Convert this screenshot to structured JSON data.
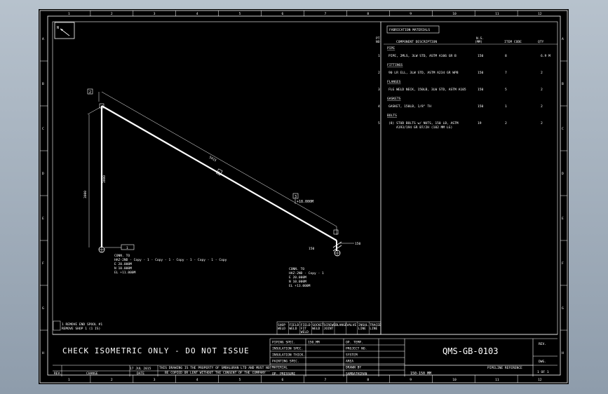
{
  "north": "N",
  "bom": {
    "title": "FABRICATION MATERIALS",
    "head_pt": "PT",
    "head_no": "NO",
    "head_desc": "COMPONENT DESCRIPTION",
    "head_ns": "N.S.",
    "head_mm": "(MM)",
    "head_item": "ITEM CODE",
    "head_qty": "QTY",
    "sections": [
      {
        "label": "PIPE",
        "rows": [
          {
            "no": "1",
            "desc": "PIPE, 2MLS, 3LW STD, ASTM A106 GR B",
            "ns": "150",
            "code": "8",
            "qty": "6.9 M"
          }
        ]
      },
      {
        "label": "FITTINGS",
        "rows": [
          {
            "no": "2",
            "desc": "90 LR ELL, 3LW STD, ASTM A234 GR WPB",
            "ns": "150",
            "code": "7",
            "qty": "2"
          }
        ]
      },
      {
        "label": "FLANGES",
        "rows": [
          {
            "no": "3",
            "desc": "FLG WELD NECK, 150LB, 3LW STD, ASTM A105",
            "ns": "150",
            "code": "5",
            "qty": "2"
          }
        ]
      },
      {
        "label": "GASKETS",
        "rows": [
          {
            "no": "4",
            "desc": "GASKET, 150LB, 1/8\" TH",
            "ns": "150",
            "code": "1",
            "qty": "2"
          }
        ]
      },
      {
        "label": "BOLTS",
        "rows": [
          {
            "no": "5",
            "desc": "(8) STUD BOLTS w/ NUTS, 150 LB, ASTM",
            "desc2": "A193/194 GR B7/2H (102 MM LG)",
            "ns": "19",
            "code": "2",
            "qty": "2"
          }
        ]
      }
    ]
  },
  "iso": {
    "label_2": "2",
    "label_1": "1",
    "label_3": "3",
    "dim_diag": "5415",
    "dim_vert": "3000",
    "dim_vert2": "3000",
    "dim_right": "150",
    "dim_right2": "150",
    "elev": "+18.000M",
    "conn_a": {
      "tag": "1",
      "l1": "CONN. TO",
      "l2": "HAZ-2ND - Copy - 1 - Copy - 1 - Copy - 1 - Copy - 1 - Copy",
      "l3": "E 20.000M",
      "l4": "N 10.000M",
      "l5": "EL +11.000M"
    },
    "conn_b": {
      "l1": "CONN. TO",
      "l2": "HAZ-2ND - Copy - 1",
      "l3": "E 20.000M",
      "l4": "N 10.000M",
      "l5": "EL +13.000M"
    }
  },
  "notes_left": {
    "l1": "1 REMOVE END SPOOL #1",
    "l2": "REMOVE SHOP 1 (1 IS)"
  },
  "symbols": [
    "SHOP WELD",
    "FIELD WELD",
    "FIELD FIT WELD",
    "SOCKET WELD",
    "SCREWED JOINT",
    "FLANGE",
    "VALVE",
    "INSUL. LINE",
    "TRACED LINE"
  ],
  "title_block": {
    "check": "CHECK ISOMETRIC ONLY - DO NOT ISSUE",
    "fields": [
      {
        "k": "PIPING SPEC.",
        "v": "150_MM"
      },
      {
        "k": "INSULATION SPEC.",
        "v": ""
      },
      {
        "k": "INSULATION THICK.",
        "v": ""
      },
      {
        "k": "PAINTING SPEC.",
        "v": ""
      },
      {
        "k": "MATERIAL",
        "v": ""
      },
      {
        "k": "OP. PRESSURE",
        "v": ""
      }
    ],
    "fields2": [
      {
        "k": "OP. TEMP.",
        "v": ""
      },
      {
        "k": "PROJECT NO.",
        "v": ""
      },
      {
        "k": "SYSTEM",
        "v": ""
      },
      {
        "k": "AREA",
        "v": ""
      },
      {
        "k": "DRAWN BY",
        "v": ""
      },
      {
        "k": "",
        "v": "SAMBATHIRAN"
      }
    ],
    "drawing_no": "QMS-GB-0103",
    "pipeline_ref_label": "PIPELINE REFERENCE",
    "pipeline_ref": "150-150_MM",
    "rev_label": "REV.",
    "dwg_label": "DWG.",
    "sheet": "1 OF 1",
    "date": "17 JUL 2015",
    "date_label": "DATE",
    "rev_col": "REV.",
    "change_col": "CHANGE",
    "disclaimer1": "THIS DRAWING IS THE PROPERTY OF SMBALURAN LTD AND MUST NOT",
    "disclaimer2": "BE COPIED OR LENT WITHOUT THE CONSENT OF THE COMPANY"
  },
  "frame_cols": [
    "1",
    "2",
    "3",
    "4",
    "5",
    "6",
    "7",
    "8",
    "9",
    "10",
    "11",
    "12"
  ],
  "frame_rows": [
    "A",
    "B",
    "C",
    "D",
    "E",
    "F",
    "G",
    "H"
  ]
}
